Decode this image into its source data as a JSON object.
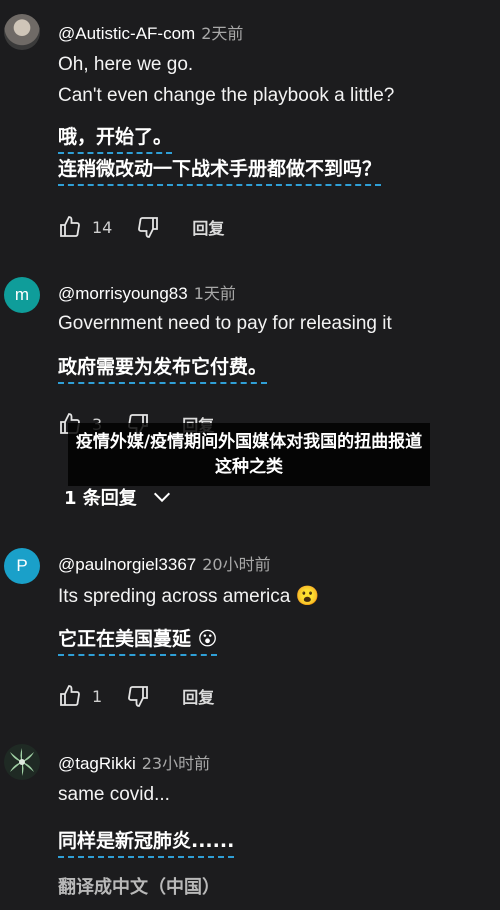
{
  "comments": [
    {
      "handle": "@Autistic-AF-com",
      "time": "2天前",
      "lines_en": [
        "Oh, here we go.",
        "Can't even change the playbook a little?"
      ],
      "lines_zh": [
        "哦，开始了。",
        "连稍微改动一下战术手册都做不到吗？"
      ],
      "likes": "14",
      "reply_label": "回复"
    },
    {
      "avatar_letter": "m",
      "handle": "@morrisyoung83",
      "time": "1天前",
      "lines_en": [
        "Government need to pay for releasing it"
      ],
      "lines_zh": [
        "政府需要为发布它付费。"
      ],
      "likes": "3",
      "reply_label": "回复",
      "replies_link": "1 条回复"
    },
    {
      "avatar_letter": "P",
      "handle": "@paulnorgiel3367",
      "time": "20小时前",
      "lines_en": [
        "Its spreding across america 😮"
      ],
      "lines_zh": [
        "它正在美国蔓延 😮"
      ],
      "likes": "1",
      "reply_label": "回复"
    },
    {
      "handle": "@tagRikki",
      "time": "23小时前",
      "lines_en": [
        "same covid..."
      ],
      "lines_zh": [
        "同样是新冠肺炎......"
      ],
      "translate_label": "翻译成中文（中国）"
    }
  ],
  "overlay_caption": "疫情外媒/疫情期间外国媒体对我国的扭曲报道这种之类",
  "colors": {
    "background": "#1c1c1e",
    "dashed_underline": "#2f9fd6",
    "avatar_m": "#0f9d9a",
    "avatar_p": "#1aa0c9"
  },
  "icons": [
    "thumbs-up-icon",
    "thumbs-down-icon",
    "chevron-down-icon"
  ]
}
